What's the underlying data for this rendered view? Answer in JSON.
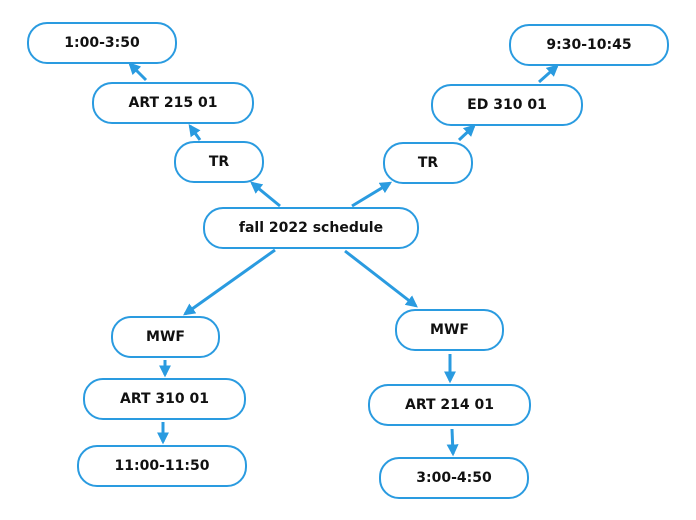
{
  "diagram": {
    "accent_color": "#2a9be0",
    "nodes": {
      "root": "fall 2022 schedule",
      "tr_left": "TR",
      "art215": "ART 215 01",
      "time_art215": "1:00-3:50",
      "tr_right": "TR",
      "ed310": "ED 310 01",
      "time_ed310": "9:30-10:45",
      "mwf_left": "MWF",
      "art310": "ART 310 01",
      "time_art310": "11:00-11:50",
      "mwf_right": "MWF",
      "art214": "ART 214 01",
      "time_art214": "3:00-4:50"
    },
    "edges": [
      [
        "root",
        "tr_left"
      ],
      [
        "tr_left",
        "art215"
      ],
      [
        "art215",
        "time_art215"
      ],
      [
        "root",
        "tr_right"
      ],
      [
        "tr_right",
        "ed310"
      ],
      [
        "ed310",
        "time_ed310"
      ],
      [
        "root",
        "mwf_left"
      ],
      [
        "mwf_left",
        "art310"
      ],
      [
        "art310",
        "time_art310"
      ],
      [
        "root",
        "mwf_right"
      ],
      [
        "mwf_right",
        "art214"
      ],
      [
        "art214",
        "time_art214"
      ]
    ]
  }
}
